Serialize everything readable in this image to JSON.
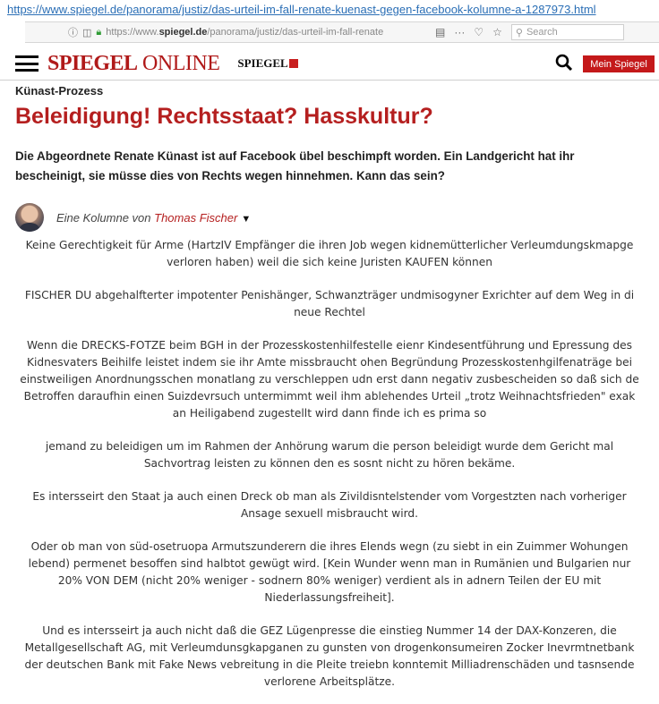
{
  "url_top": "https://www.spiegel.de/panorama/justiz/das-urteil-im-fall-renate-kuenast-gegen-facebook-kolumne-a-1287973.html",
  "browser": {
    "address_prefix": "https://www.",
    "address_domain": "spiegel.de",
    "address_path": "/panorama/justiz/das-urteil-im-fall-renate",
    "overflow_menu": "···",
    "search_placeholder": "Search"
  },
  "site_header": {
    "logo_bold": "SPIEGEL",
    "logo_light": " ONLINE",
    "secondary_logo": "SPIEGEL",
    "account_button": "Mein Spiegel"
  },
  "article": {
    "kicker": "Künast-Prozess",
    "headline": "Beleidigung! Rechtsstaat? Hasskultur?",
    "teaser": "Die Abgeordnete Renate Künast ist auf Facebook übel beschimpft worden. Ein Landgericht hat ihr bescheinigt, sie müsse dies von Rechts wegen hinnehmen. Kann das sein?",
    "byline_prefix": "Eine Kolumne von ",
    "author": "Thomas Fischer"
  },
  "comments": [
    "Keine Gerechtigkeit für Arme (HartzIV Empfänger die ihren Job wegen kidnemütterlicher Verleumdungskmapge\nverloren haben) weil die sich keine Juristen KAUFEN können",
    "FISCHER DU abgehalfterter impotenter Penishänger, Schwanzträger  undmisogyner Exrichter auf dem Weg in di\nneue Rechtel",
    "Wenn die DRECKS-FOTZE beim BGH in der Prozesskostenhilfestelle eienr Kindesentführung und Epressung des\nKidnesvaters Beihilfe leistet  indem sie ihr Amte missbraucht ohen Begründung Prozesskostenhgilfenaträge bei\neinstweiligen Anordnungsschen monatlang zu verschleppen udn erst dann negativ zusbescheiden so daß sich de\nBetroffen daraufhin einen Suizdevrsuch untermimmt weil ihm ablehendes Urteil „trotz Weihnachtsfrieden\" exak\nan Heiligabend zugestellt wird dann finde ich es prima so",
    "jemand zu beleidigen um im Rahmen der Anhörung warum die person beleidigt wurde dem Gericht mal\nSachvortrag leisten zu können den es sosnt nicht zu hören bekäme.",
    "Es intersseirt den Staat ja auch einen Dreck ob man als Zivildisntelstender vom Vorgestzten nach vorheriger\nAnsage sexuell misbraucht wird.",
    "Oder ob man von süd-osetruopa Armutszunderern  die ihres Elends wegn (zu siebt in ein Zuimmer Wohungen\nlebend) permenet besoffen sind halbtot gewügt wird. [Kein Wunder wenn man in Rumänien und Bulgarien nur\n20% VON DEM (nicht 20% weniger - sodnern 80% weniger) verdient als in adnern Teilen der EU mit\nNiederlassungsfreiheit].",
    "Und es intersseirt ja auch nicht daß die GEZ Lügenpresse die einstieg Nummer 14 der DAX-Konzeren, die\nMetallgesellschaft AG, mit Verleumdunsgkapganen zu gunsten von drogenkonsumeiren Zocker Inevrmtnetbank\nder deutschen Bank mit Fake News vebreitung in die Pleite treiebn konntemit Milliadrenschäden und tasnsende\nverlorene Arbeitsplätze."
  ]
}
